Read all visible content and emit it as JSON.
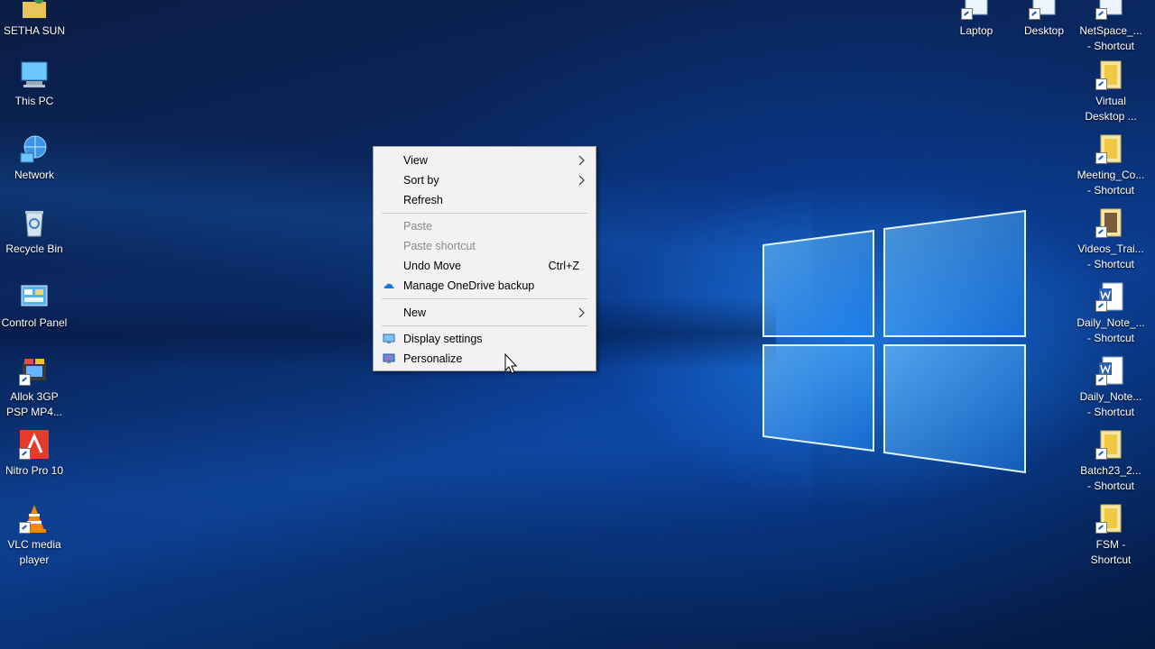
{
  "desktop_left": [
    {
      "id": "user",
      "label": "SETHA SUN"
    },
    {
      "id": "this-pc",
      "label": "This PC"
    },
    {
      "id": "network",
      "label": "Network"
    },
    {
      "id": "recycle-bin",
      "label": "Recycle Bin"
    },
    {
      "id": "control-panel",
      "label": "Control Panel"
    },
    {
      "id": "allok",
      "label1": "Allok 3GP",
      "label2": "PSP MP4..."
    },
    {
      "id": "nitro",
      "label": "Nitro Pro 10"
    },
    {
      "id": "vlc",
      "label1": "VLC media",
      "label2": "player"
    }
  ],
  "desktop_top": [
    {
      "id": "laptop",
      "label": "Laptop"
    },
    {
      "id": "desktop",
      "label": "Desktop"
    },
    {
      "id": "netspace",
      "label1": "NetSpace_...",
      "label2": "- Shortcut"
    }
  ],
  "desktop_right": [
    {
      "id": "virtual-desktop",
      "label1": "Virtual",
      "label2": "Desktop ..."
    },
    {
      "id": "meeting",
      "label1": "Meeting_Co...",
      "label2": "- Shortcut"
    },
    {
      "id": "videos",
      "label1": "Videos_Trai...",
      "label2": "- Shortcut"
    },
    {
      "id": "daily-note-1",
      "label1": "Daily_Note_...",
      "label2": "- Shortcut"
    },
    {
      "id": "daily-note-2",
      "label1": "Daily_Note...",
      "label2": "- Shortcut"
    },
    {
      "id": "batch23",
      "label1": "Batch23_2...",
      "label2": "- Shortcut"
    },
    {
      "id": "fsm",
      "label1": "FSM -",
      "label2": "Shortcut"
    }
  ],
  "context_menu": {
    "view": "View",
    "sort_by": "Sort by",
    "refresh": "Refresh",
    "paste": "Paste",
    "paste_shortcut": "Paste shortcut",
    "undo_move": "Undo Move",
    "undo_shortcut": "Ctrl+Z",
    "onedrive": "Manage OneDrive backup",
    "new": "New",
    "display_settings": "Display settings",
    "personalize": "Personalize"
  },
  "icons": {
    "chevron": "chevron-right-icon",
    "onedrive": "onedrive-cloud-icon",
    "display": "display-settings-icon",
    "personalize": "personalize-icon"
  },
  "colors": {
    "menu_bg": "#f2f2f2",
    "disabled_text": "#8a8a8a",
    "accent": "#1a75d9"
  }
}
